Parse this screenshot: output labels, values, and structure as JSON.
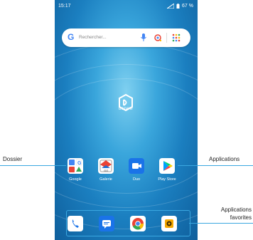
{
  "status": {
    "time": "15:17",
    "battery": "67 %"
  },
  "search": {
    "placeholder": "Rechercher..."
  },
  "brand": {
    "logo_text": "danew"
  },
  "apps": [
    {
      "label": "Google",
      "icon": "folder-icon"
    },
    {
      "label": "Galerie",
      "icon": "gallery-icon"
    },
    {
      "label": "Duo",
      "icon": "duo-icon"
    },
    {
      "label": "Play Store",
      "icon": "play-store-icon"
    }
  ],
  "dock": [
    {
      "icon": "phone-icon"
    },
    {
      "icon": "messages-icon"
    },
    {
      "icon": "chrome-icon"
    },
    {
      "icon": "camera-icon"
    }
  ],
  "callouts": {
    "dossier": "Dossier",
    "applications": "Applications",
    "favorites_line1": "Applications",
    "favorites_line2": "favorites"
  }
}
